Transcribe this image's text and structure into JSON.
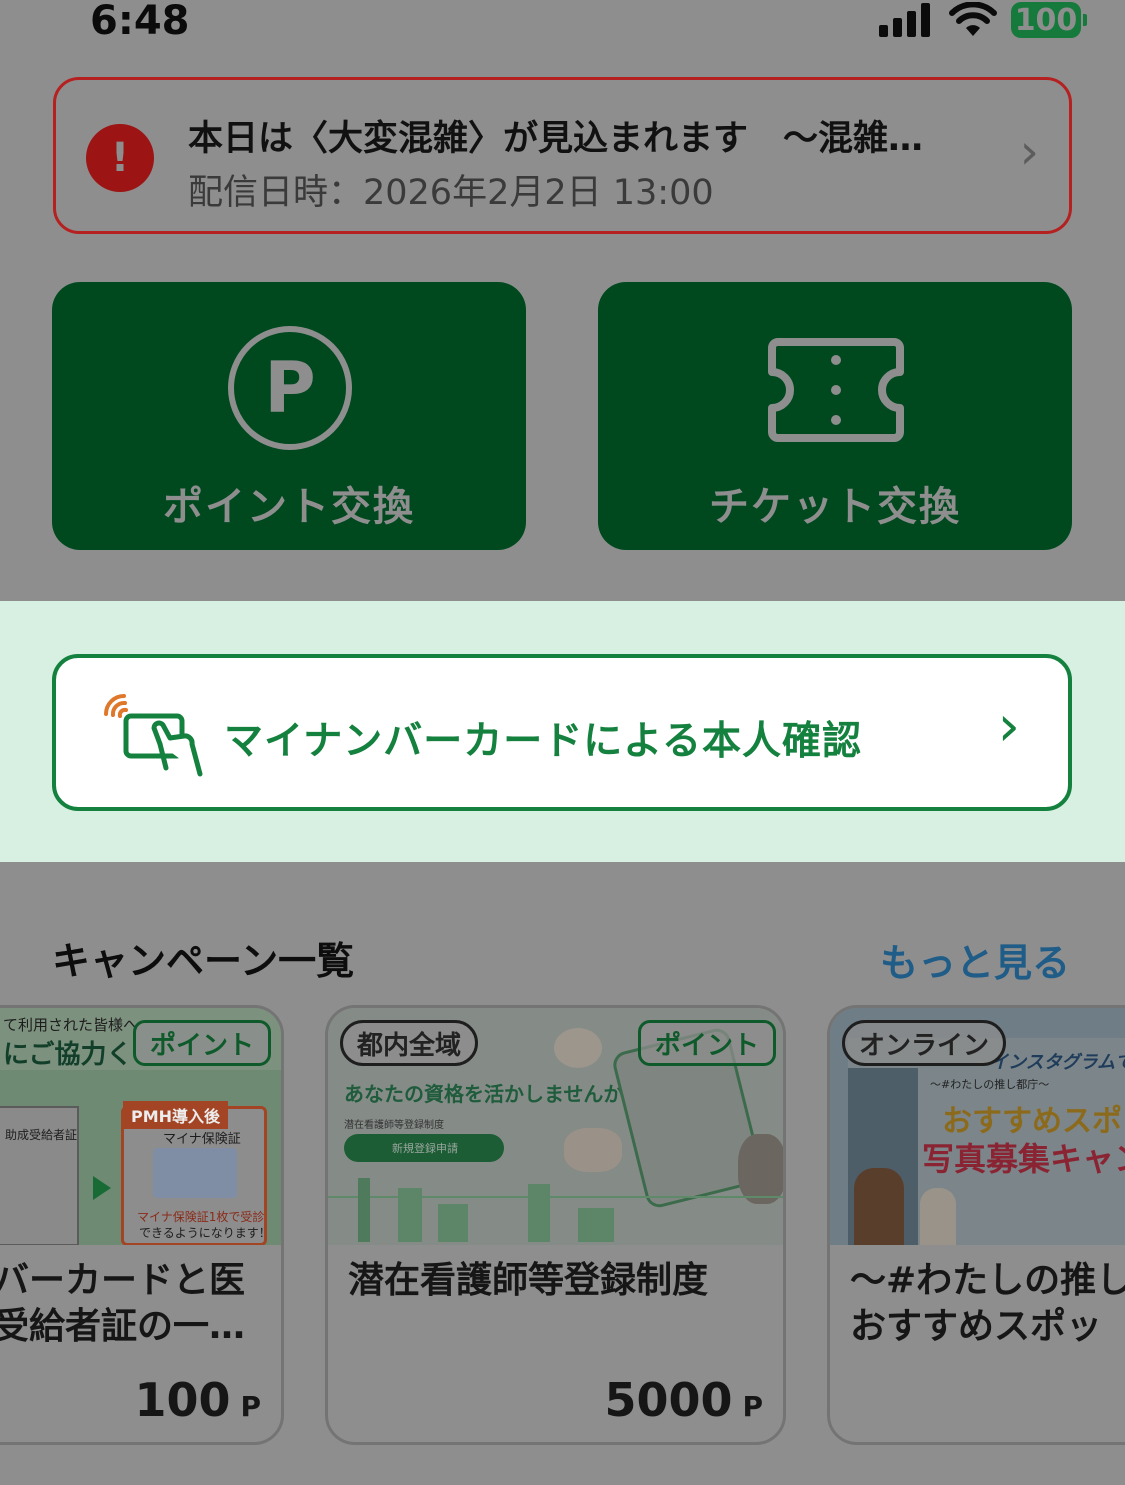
{
  "status_bar": {
    "time": "6:48",
    "battery": "100"
  },
  "alert": {
    "icon": "!",
    "title": "本日は〈大変混雑〉が見込まれます　〜混雑…",
    "date": "配信日時：2026年2月2日 13:00"
  },
  "tiles": [
    {
      "label": "ポイント交換",
      "icon": "P"
    },
    {
      "label": "チケット交換",
      "icon": "ticket-icon"
    }
  ],
  "mynumber": {
    "label": "マイナンバーカードによる本人確認"
  },
  "campaigns": {
    "title": "キャンペーン一覧",
    "more": "もっと見る",
    "items": [
      {
        "tag": "ポイント",
        "title": "バーカードと医受給者証の一…",
        "title_line1": "バーカードと医",
        "title_line2": "受給者証の一…",
        "points": "100",
        "unit": "P",
        "img_text": {
          "t1": "て利用された皆様へ",
          "t2": "にご協力く",
          "t3": "PMH導入後",
          "t4": "マイナ保険証",
          "t5": "助成受給者証",
          "t6": "マイナ保険証1枚で受診",
          "t7": "できるようになります！"
        }
      },
      {
        "tag_area": "都内全域",
        "tag": "ポイント",
        "title": "潜在看護師等登録制度",
        "points": "5000",
        "unit": "P",
        "img_text": {
          "t1": "あなたの資格を活かしませんか？",
          "t2": "潜在看護師等登録制度",
          "t3": "新規登録申請"
        }
      },
      {
        "tag": "オンライン",
        "title_line1": "〜#わたしの推し",
        "title_line2": "おすすめスポッ",
        "img_text": {
          "t1": "インスタグラムで",
          "t2": "〜#わたしの推し都庁〜",
          "t3": "おすすめスポ",
          "t4": "写真募集キャン"
        }
      }
    ]
  }
}
